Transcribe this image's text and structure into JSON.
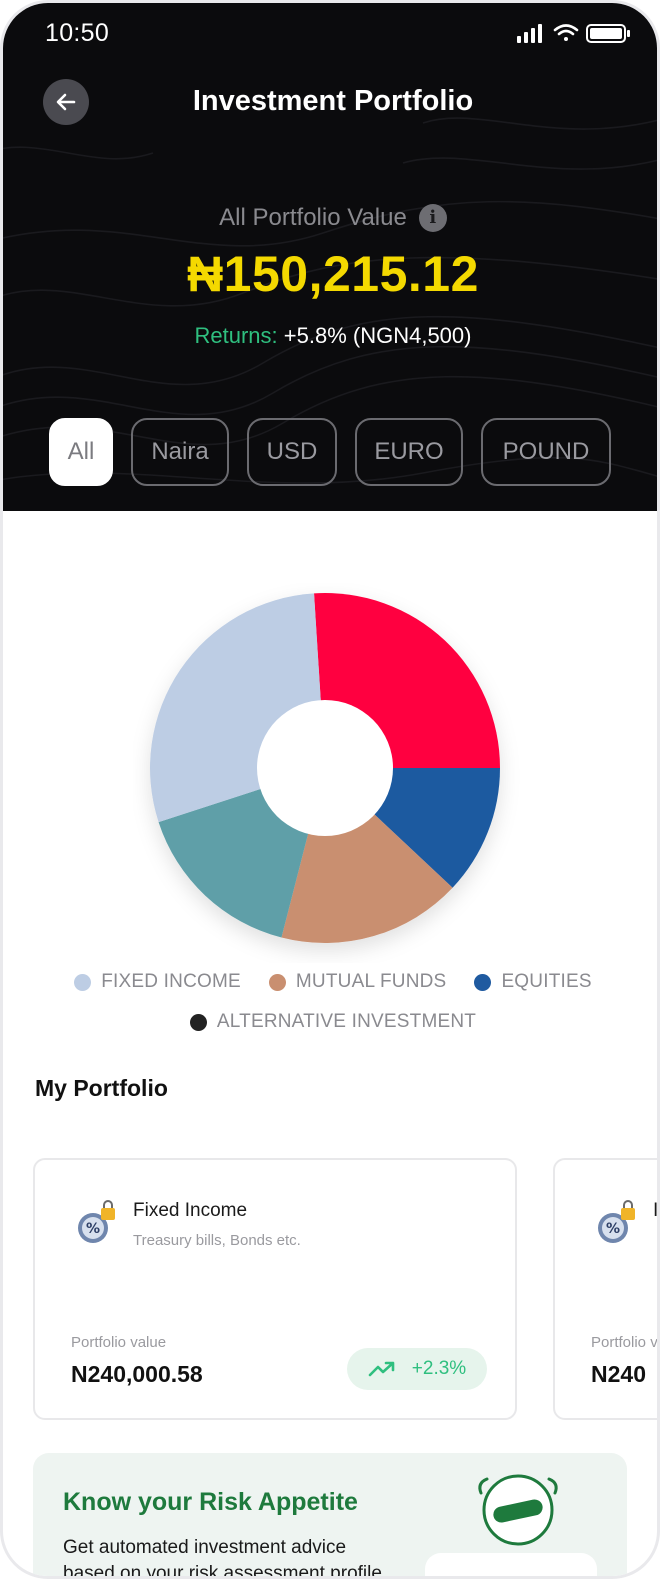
{
  "status_bar": {
    "time": "10:50"
  },
  "header": {
    "title": "Investment Portfolio"
  },
  "portfolio_value": {
    "label": "All Portfolio Value",
    "value": "₦150,215.12",
    "returns_label": "Returns:",
    "returns_value": "+5.8% (NGN4,500)"
  },
  "filters": [
    {
      "label": "All",
      "active": true
    },
    {
      "label": "Naira",
      "active": false
    },
    {
      "label": "USD",
      "active": false
    },
    {
      "label": "EURO",
      "active": false
    },
    {
      "label": "POUND",
      "active": false
    }
  ],
  "chart_data": {
    "type": "pie",
    "slices": [
      {
        "color": "#ff0040",
        "value": 26
      },
      {
        "color": "#1f5aa0",
        "value": 12
      },
      {
        "color": "#c98f70",
        "value": 17
      },
      {
        "color": "#5f9fa8",
        "value": 16
      },
      {
        "color": "#bdcde4",
        "value": 29
      }
    ],
    "legend": [
      {
        "label": "FIXED INCOME",
        "color": "#bdcde4"
      },
      {
        "label": "MUTUAL FUNDS",
        "color": "#c98f70"
      },
      {
        "label": "EQUITIES",
        "color": "#1f5aa0"
      },
      {
        "label": "ALTERNATIVE INVESTMENT",
        "color": "#222222"
      }
    ]
  },
  "my_portfolio": {
    "title": "My Portfolio",
    "cards": [
      {
        "name": "Fixed Income",
        "subtitle": "Treasury bills, Bonds etc.",
        "value_label": "Portfolio value",
        "value": "N240,000.58",
        "change": "+2.3%"
      },
      {
        "name": "I",
        "subtitle": "",
        "value_label": "Portfolio v",
        "value": "N240"
      }
    ]
  },
  "risk_card": {
    "title": "Know your Risk Appetite",
    "description": "Get automated investment advice based on your risk assessment profile"
  },
  "colors": {
    "accent_yellow": "#f4d900",
    "positive_green": "#2fbf7f",
    "risk_title_green": "#1e7a3d"
  }
}
